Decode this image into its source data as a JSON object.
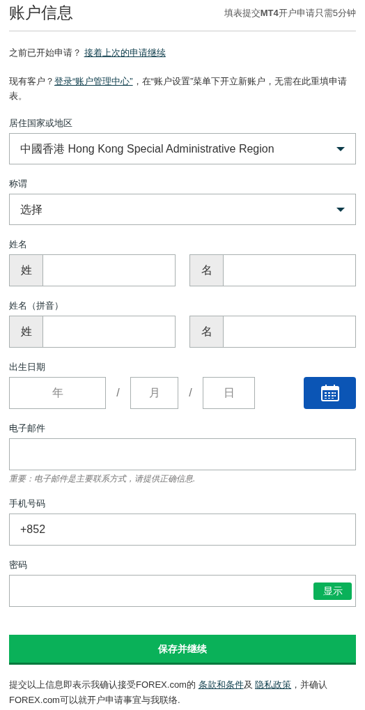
{
  "header": {
    "title": "账户信息",
    "note": "填表提交**MT4**开户申请只需5分钟"
  },
  "intro": [
    {
      "segments": [
        {
          "kind": "text",
          "text": "之前已开始申请？ "
        },
        {
          "kind": "link",
          "text": "接着上次的申请继续"
        }
      ]
    },
    {
      "segments": [
        {
          "kind": "text",
          "text": "现有客户？"
        },
        {
          "kind": "link",
          "text": "登录“账户管理中心”"
        },
        {
          "kind": "text",
          "text": "，在“账户设置”菜单下开立新账户，无需在此重填申请表。"
        }
      ]
    }
  ],
  "fields": [
    {
      "kind": "select",
      "label": "居住国家或地区",
      "value": "中國香港 Hong Kong Special Administrative Region"
    },
    {
      "kind": "select",
      "label": "称谓",
      "value": "选择"
    },
    {
      "kind": "name_pair",
      "label": "姓名",
      "parts": [
        {
          "prefix": "姓"
        },
        {
          "prefix": "名"
        }
      ]
    },
    {
      "kind": "name_pair",
      "label": "姓名（拼音）",
      "parts": [
        {
          "prefix": "姓"
        },
        {
          "prefix": "名"
        }
      ]
    },
    {
      "kind": "date",
      "label": "出生日期",
      "parts": [
        {
          "placeholder": "年"
        },
        {
          "placeholder": "月"
        },
        {
          "placeholder": "日"
        }
      ],
      "separators": [
        "/",
        "/"
      ]
    },
    {
      "kind": "text",
      "label": "电子邮件",
      "hint": "重要：电子邮件是主要联系方式，请提供正确信息."
    },
    {
      "kind": "text",
      "label": "手机号码",
      "value": "+852"
    },
    {
      "kind": "password",
      "label": "密码",
      "button": "显示"
    }
  ],
  "submit": "保存并继续",
  "footer": {
    "segments": [
      {
        "kind": "text",
        "text": "提交以上信息即表示我确认接受FOREX.com的 "
      },
      {
        "kind": "link",
        "text": "条款和条件"
      },
      {
        "kind": "text",
        "text": "及 "
      },
      {
        "kind": "link",
        "text": "隐私政策"
      },
      {
        "kind": "text",
        "text": "，并确认FOREX.com可以就开户申请事宜与我联络."
      }
    ]
  }
}
